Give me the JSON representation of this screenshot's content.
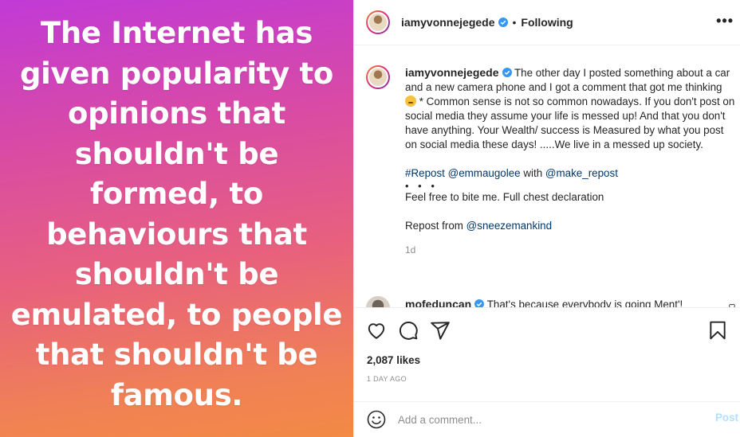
{
  "image": {
    "quote_lines": [
      "The Internet has",
      "given popularity to",
      "opinions that",
      "shouldn't be",
      "formed, to",
      "behaviours that",
      "shouldn't be",
      "emulated, to people",
      "that shouldn't be",
      "famous."
    ]
  },
  "header": {
    "username": "iamyvonnejegede",
    "separator": "•",
    "follow_status": "Following",
    "more_icon": "more-horizontal-icon",
    "verified_icon": "verified-badge-icon"
  },
  "caption": {
    "username": "iamyvonnejegede",
    "text_part1": "The other day I posted something about a car and a new camera phone and I got a comment that got me thinking",
    "emoji_icon": "thinking-face-icon",
    "text_part2": "* Common sense is not so common nowadays. If you don't post on social media they assume your life is messed up! And that you don't have anything. Your Wealth/ success is Measured by what you post on social media these days! .....We live in a messed up society.",
    "repost_hashtag": "#Repost",
    "repost_user": "@emmaugolee",
    "repost_with": "with",
    "repost_app": "@make_repost",
    "ellipsis": "• • •",
    "line_bite": "Feel free to bite me. Full chest declaration",
    "repost_from_label": "Repost from",
    "repost_from_user": "@sneezemankind",
    "timestamp": "1d"
  },
  "reply": {
    "username": "mofeduncan",
    "text": "That's because everybody is going Ment'!"
  },
  "actions": {
    "like_icon": "heart-icon",
    "comment_icon": "comment-icon",
    "share_icon": "share-icon",
    "save_icon": "bookmark-icon",
    "likes": "2,087 likes",
    "post_age": "1 DAY AGO"
  },
  "add_comment": {
    "emoji_icon": "smiley-icon",
    "placeholder": "Add a comment...",
    "post_label": "Post"
  },
  "colors": {
    "link": "#00376b",
    "verified": "#3897f0",
    "post_disabled": "#b2dffc",
    "muted": "#8e8e8e",
    "gradient_top": "#c13ad6",
    "gradient_bottom": "#f38a45"
  }
}
